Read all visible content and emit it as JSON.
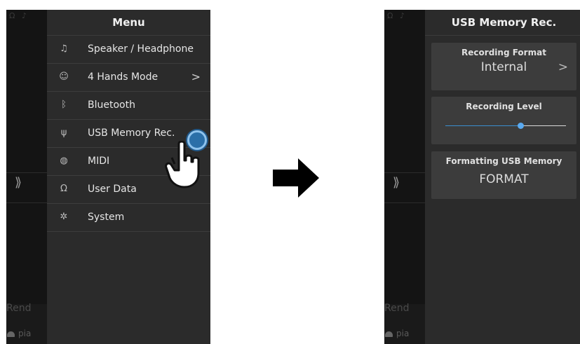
{
  "left": {
    "background": {
      "truncated_text": "Rend",
      "status": "pia",
      "chevron": "⟫"
    },
    "menu": {
      "title": "Menu",
      "items": [
        {
          "icon": "headphone-icon",
          "glyph": "♫",
          "label": "Speaker / Headphone",
          "arrow": ""
        },
        {
          "icon": "four-hands-icon",
          "glyph": "☺",
          "label": "4 Hands Mode",
          "arrow": ">"
        },
        {
          "icon": "bluetooth-icon",
          "glyph": "ᛒ",
          "label": "Bluetooth",
          "arrow": ""
        },
        {
          "icon": "usb-icon",
          "glyph": "ψ",
          "label": "USB Memory Rec.",
          "arrow": ""
        },
        {
          "icon": "midi-icon",
          "glyph": "◍",
          "label": "MIDI",
          "arrow": ""
        },
        {
          "icon": "user-data-icon",
          "glyph": "Ω",
          "label": "User Data",
          "arrow": ""
        },
        {
          "icon": "system-icon",
          "glyph": "✲",
          "label": "System",
          "arrow": ""
        }
      ]
    }
  },
  "right": {
    "background": {
      "truncated_text": "Rend",
      "status": "pia",
      "chevron": "⟫"
    },
    "title": "USB Memory Rec.",
    "recording_format": {
      "label": "Recording Format",
      "value": "Internal",
      "arrow": ">"
    },
    "recording_level": {
      "label": "Recording Level",
      "level_fraction": 0.62
    },
    "formatting": {
      "label": "Formatting USB Memory",
      "button": "FORMAT"
    }
  },
  "colors": {
    "accent": "#3a8fd0",
    "panel": "#2b2b2b",
    "background": "#141414"
  }
}
